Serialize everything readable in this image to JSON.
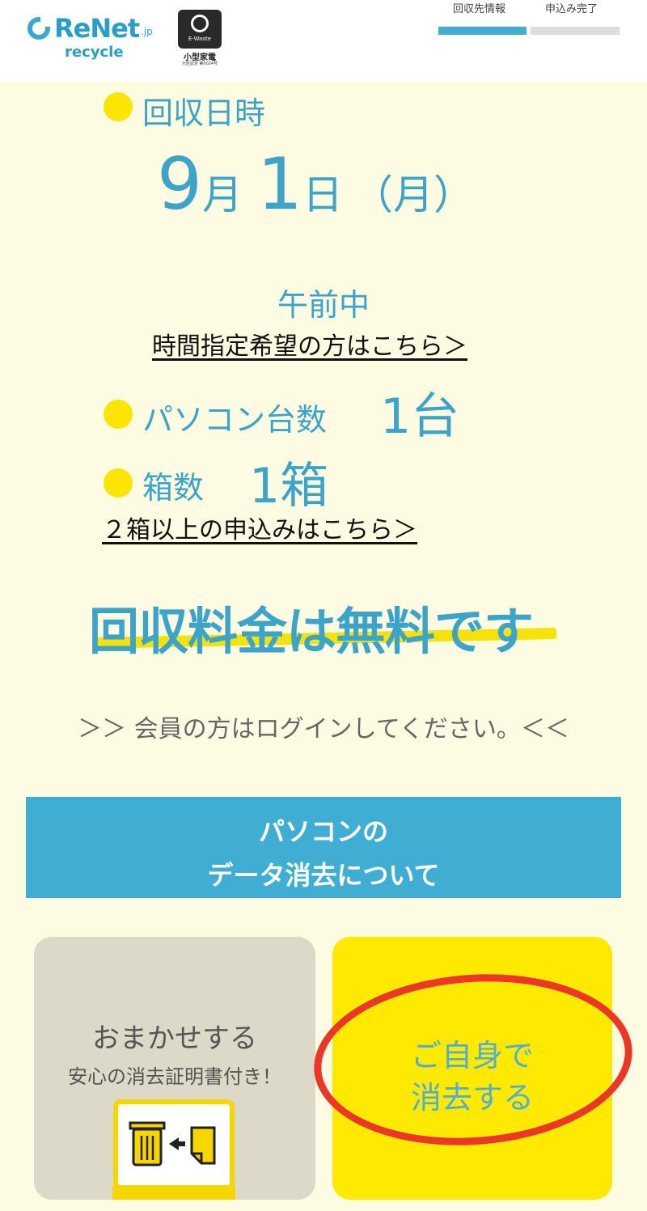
{
  "header": {
    "logo_main": "ReNet",
    "logo_suffix": ".jp",
    "logo_sub": "recycle",
    "badge_ewaste": "E-Waste",
    "badge_title": "小型家電",
    "badge_cert": "大臣認定 第0024号",
    "steps": [
      {
        "label": "回収先情報",
        "active": true
      },
      {
        "label": "申込み完了",
        "active": false
      }
    ],
    "active_color": "#40aed2",
    "inactive_color": "#dddddd"
  },
  "pickup": {
    "date_heading": "回収日時",
    "month_num": "9",
    "month_unit": "月",
    "day_num": "1",
    "day_unit": "日",
    "weekday": "（月）",
    "time_slot": "午前中",
    "time_link": "時間指定希望の方はこちら＞",
    "pc_label": "パソコン台数",
    "pc_count": "1台",
    "box_label": "箱数",
    "box_count": "1箱",
    "box_link": "２箱以上の申込みはこちら＞"
  },
  "fee_text": "回収料金は無料です",
  "login_text": "＞＞ 会員の方はログインしてください。＜＜",
  "data_erase": {
    "banner_line1": "パソコンの",
    "banner_line2": "データ消去について",
    "option_left_title": "おまかせする",
    "option_left_sub": "安心の消去証明書付き！",
    "option_right_line1": "ご自身で",
    "option_right_line2": "消去する"
  },
  "colors": {
    "accent_blue": "#3ca4c9",
    "yellow": "#fce500",
    "background": "#fdfbe2",
    "annotation_red": "#ec3626"
  }
}
